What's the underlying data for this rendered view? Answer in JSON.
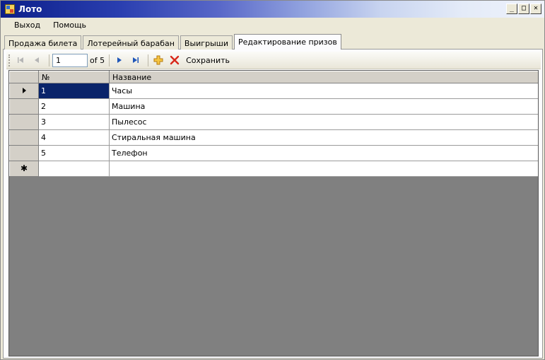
{
  "window": {
    "title": "Лото",
    "controls": {
      "minimize": "_",
      "maximize": "□",
      "close": "✕"
    }
  },
  "menu": [
    "Выход",
    "Помощь"
  ],
  "tabs": [
    {
      "label": "Продажа билета",
      "active": false
    },
    {
      "label": "Лотерейный барабан",
      "active": false
    },
    {
      "label": "Выигрыши",
      "active": false
    },
    {
      "label": "Редактирование призов",
      "active": true
    }
  ],
  "navigator": {
    "position": "1",
    "count_label": "of 5",
    "save_label": "Сохранить",
    "icons": [
      "move-first-icon",
      "move-previous-icon",
      "move-next-icon",
      "move-last-icon",
      "add-new-icon",
      "delete-icon"
    ]
  },
  "grid": {
    "columns": [
      "№",
      "Название"
    ],
    "rows": [
      {
        "num": "1",
        "name": "Часы"
      },
      {
        "num": "2",
        "name": "Машина"
      },
      {
        "num": "3",
        "name": "Пылесос"
      },
      {
        "num": "4",
        "name": "Стиральная машина"
      },
      {
        "num": "5",
        "name": "Телефон"
      }
    ],
    "current_row_marker": "▶",
    "new_row_marker": "✱"
  },
  "colors": {
    "selection": "#0a246a",
    "grid_background": "#808080",
    "title_gradient_start": "#0c1f8a"
  }
}
